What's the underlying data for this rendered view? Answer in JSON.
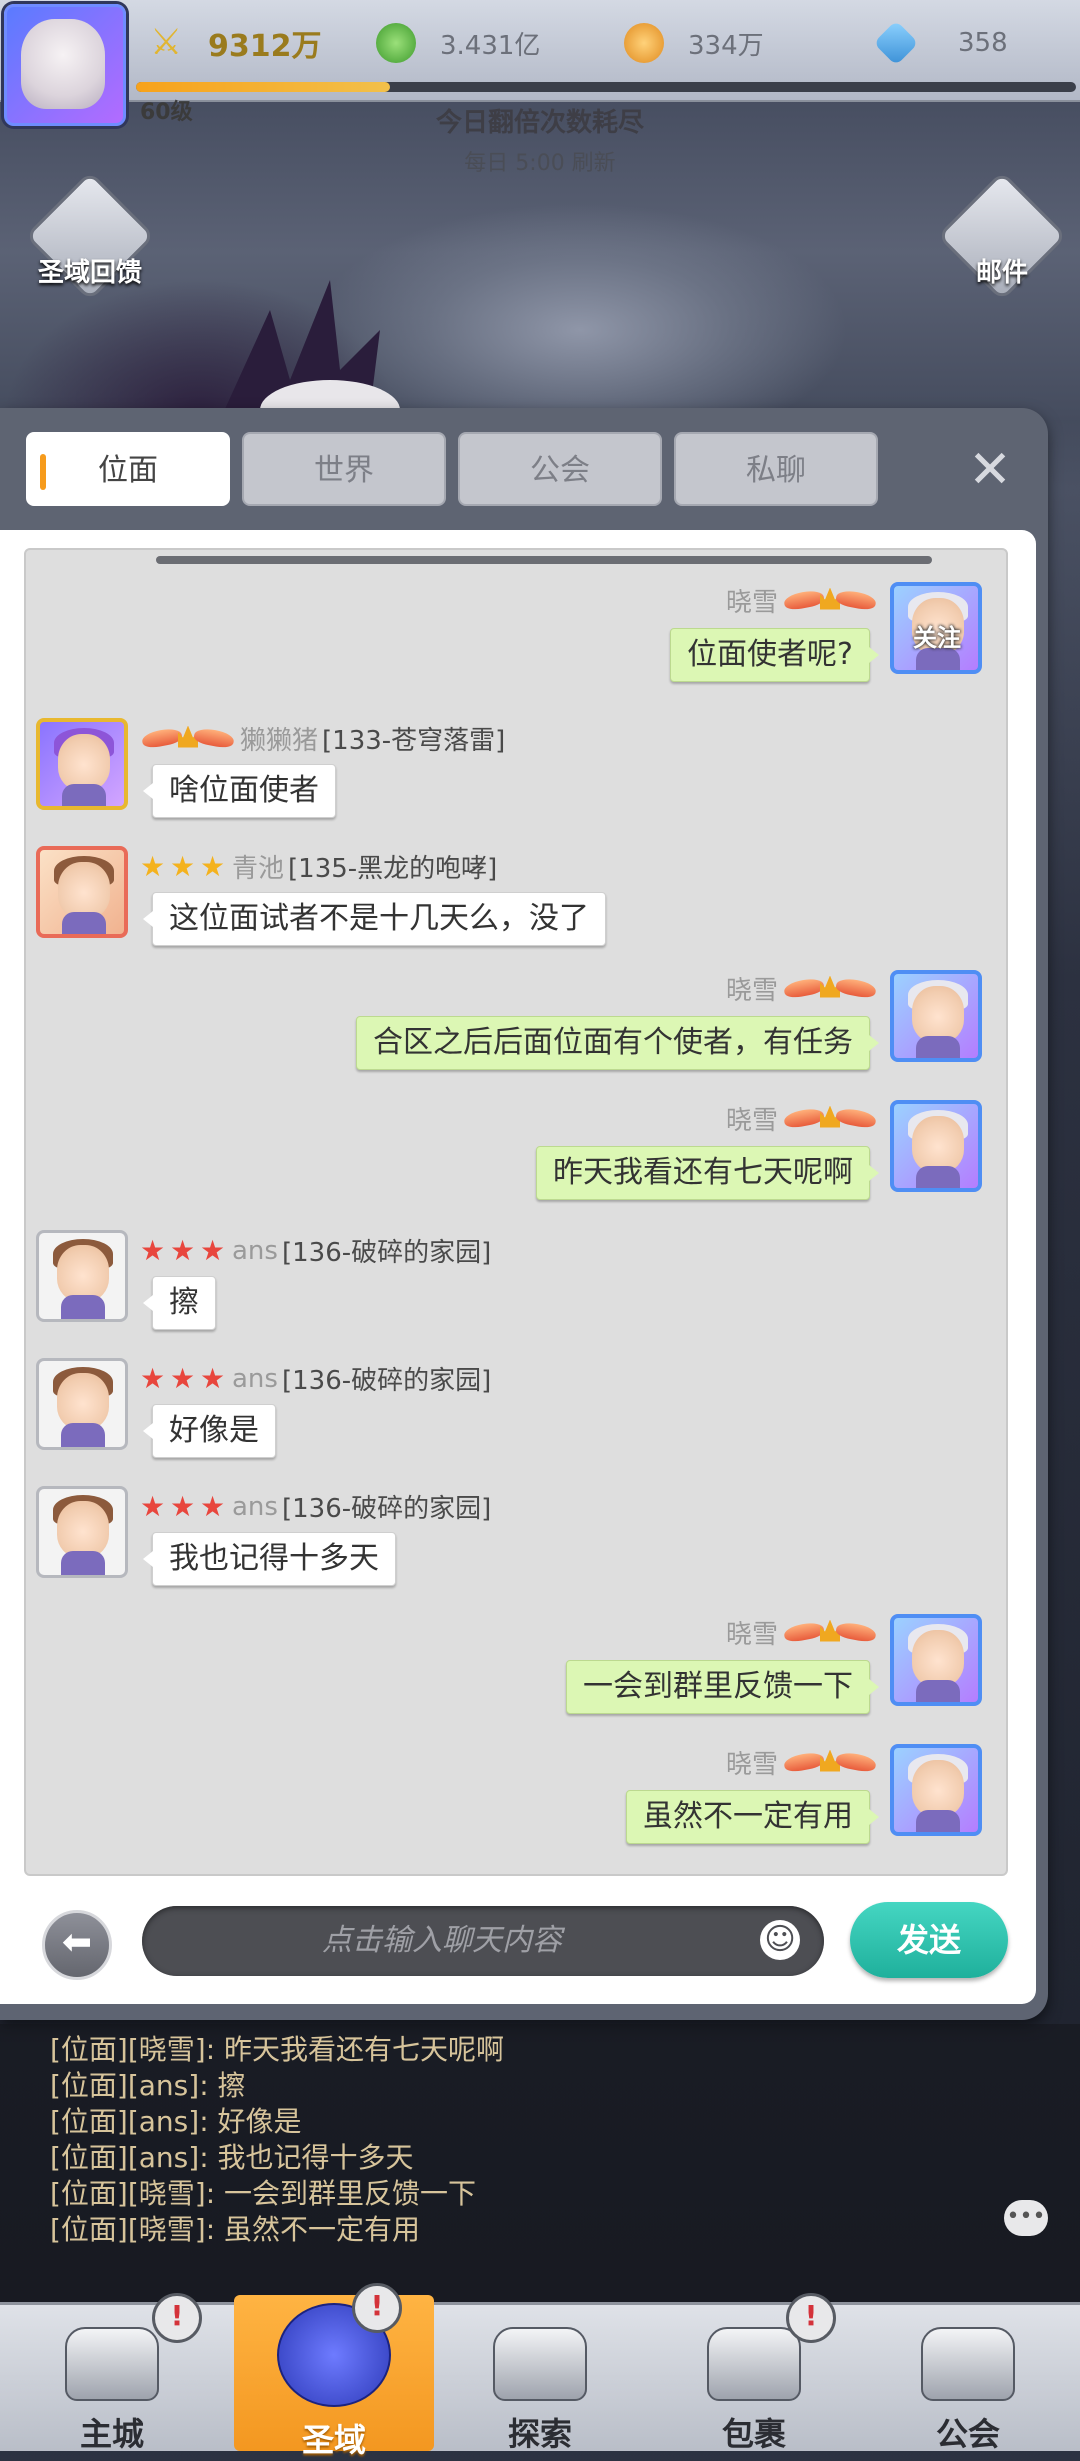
{
  "top_bar": {
    "power": "9312万",
    "gold": "3.431亿",
    "coin": "334万",
    "gem": "358",
    "level": "60级",
    "exp_progress": 0.27
  },
  "notice": {
    "line1": "今日翻倍次数耗尽",
    "line2": "每日 5:00 刷新"
  },
  "side_buttons": {
    "left": "圣域回馈",
    "right": "邮件"
  },
  "chat": {
    "tabs": [
      "位面",
      "世界",
      "公会",
      "私聊"
    ],
    "active_tab": 0,
    "close_icon": "close-icon",
    "messages": [
      {
        "side": "right",
        "name": "晓雪",
        "text": "位面使者呢?",
        "badge": "关注"
      },
      {
        "side": "left",
        "name": "獭獭猪",
        "server": "[133-苍穹落雷]",
        "text": "啥位面使者"
      },
      {
        "side": "left",
        "name": "青池",
        "server": "[135-黑龙的咆哮]",
        "text": "这位面试者不是十几天么，没了"
      },
      {
        "side": "right",
        "name": "晓雪",
        "text": "合区之后后面位面有个使者，有任务"
      },
      {
        "side": "right",
        "name": "晓雪",
        "text": "昨天我看还有七天呢啊"
      },
      {
        "side": "left",
        "name": "ans",
        "server": "[136-破碎的家园]",
        "text": "擦"
      },
      {
        "side": "left",
        "name": "ans",
        "server": "[136-破碎的家园]",
        "text": "好像是"
      },
      {
        "side": "left",
        "name": "ans",
        "server": "[136-破碎的家园]",
        "text": "我也记得十多天"
      },
      {
        "side": "right",
        "name": "晓雪",
        "text": "一会到群里反馈一下"
      },
      {
        "side": "right",
        "name": "晓雪",
        "text": "虽然不一定有用"
      }
    ],
    "input_placeholder": "点击输入聊天内容",
    "send_label": "发送"
  },
  "chat_log": [
    "[位面][晓雪]:  昨天我看还有七天呢啊",
    "[位面][ans]:  擦",
    "[位面][ans]:  好像是",
    "[位面][ans]:  我也记得十多天",
    "[位面][晓雪]:  一会到群里反馈一下",
    "[位面][晓雪]:  虽然不一定有用"
  ],
  "bottom_nav": {
    "items": [
      "主城",
      "圣域",
      "探索",
      "包裹",
      "公会"
    ],
    "active": 1,
    "badge_symbol": "!"
  }
}
